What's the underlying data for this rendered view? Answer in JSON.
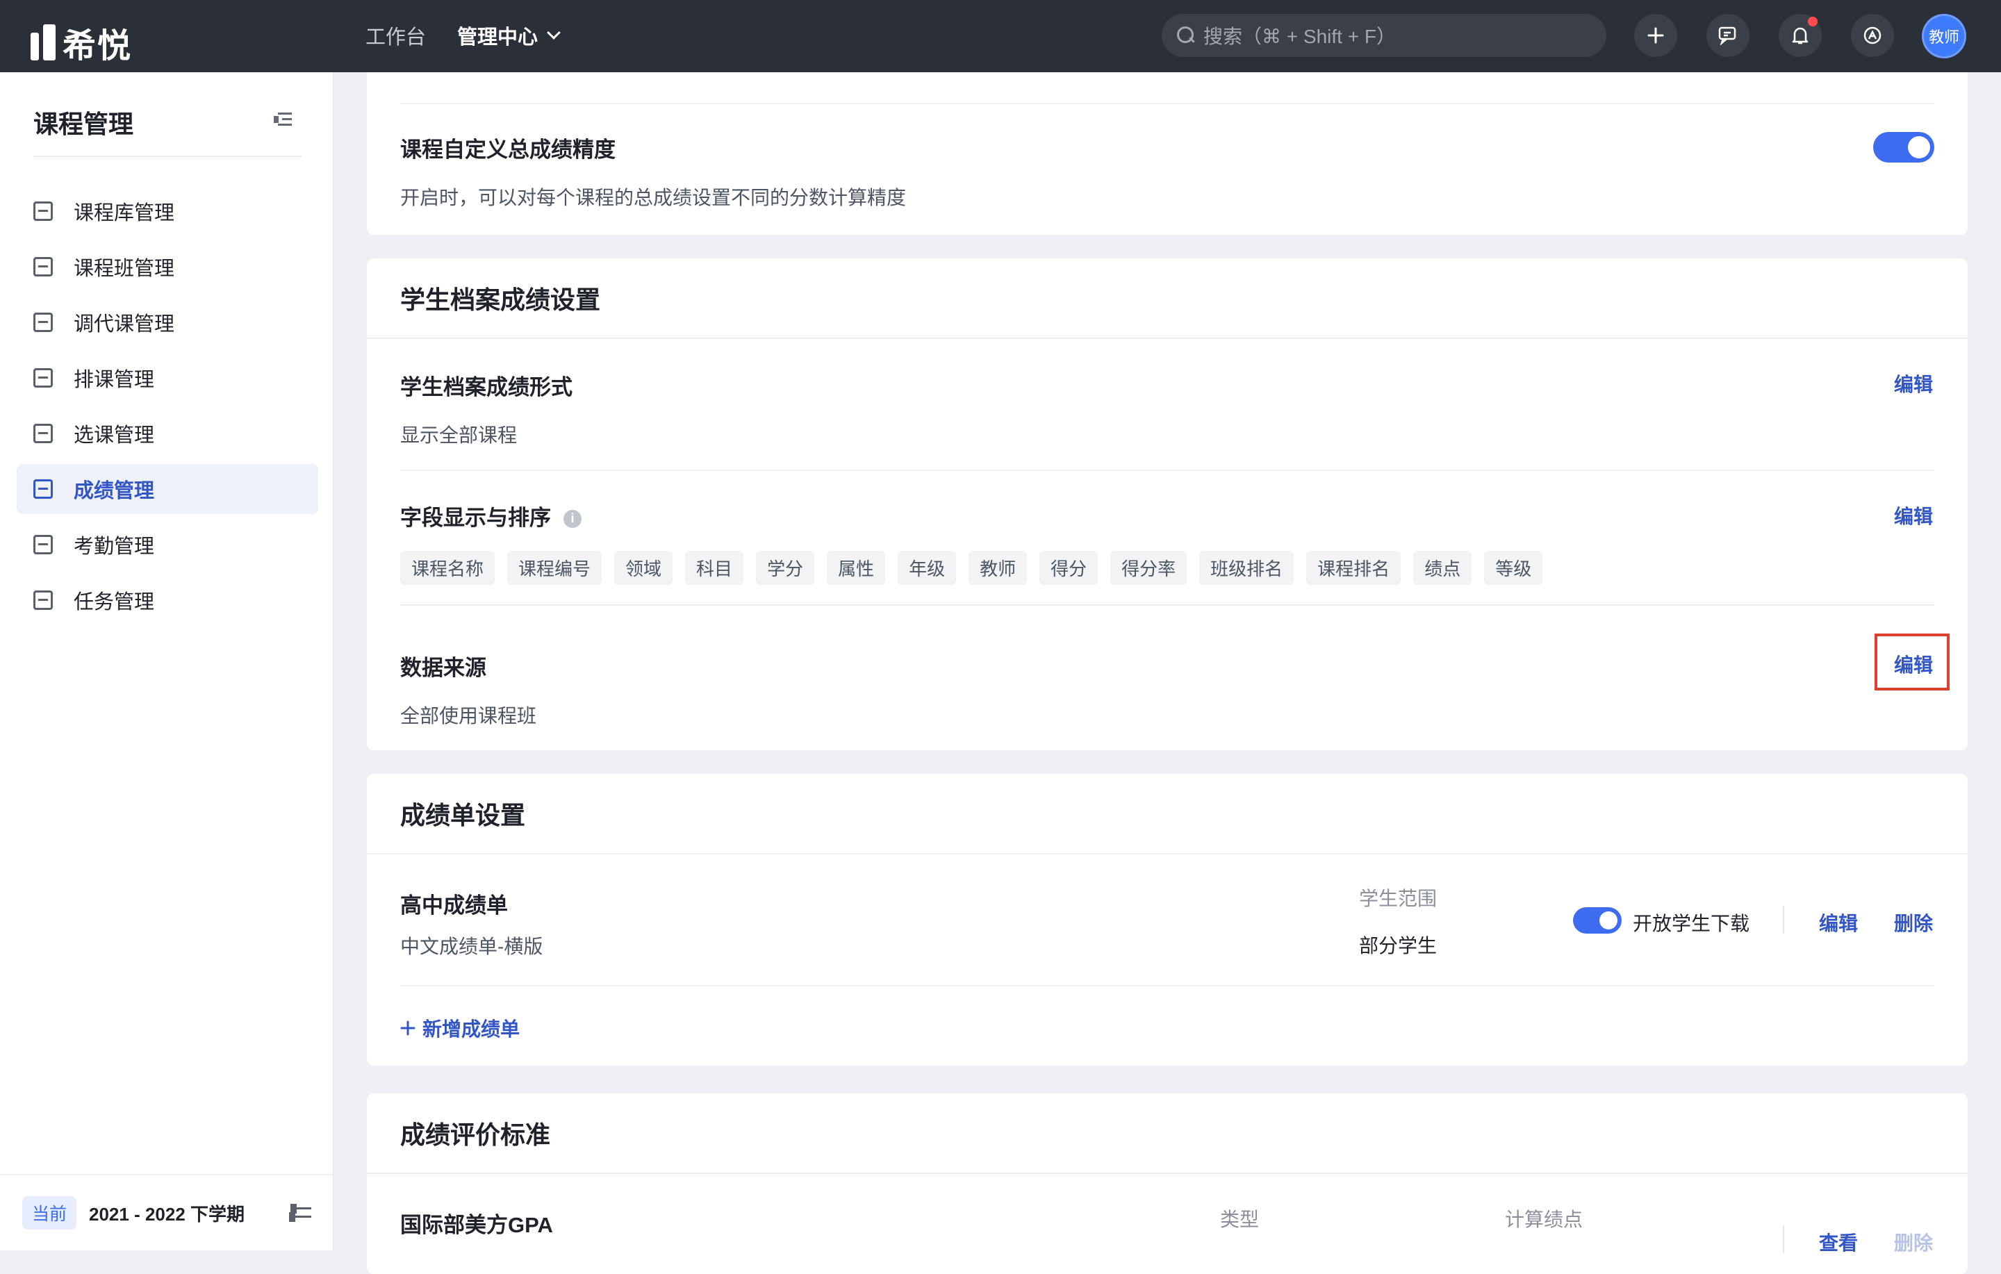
{
  "topbar": {
    "logo_text": "希悦",
    "nav": {
      "workbench": "工作台",
      "admin": "管理中心"
    },
    "search_placeholder": "搜索（⌘ + Shift + F）",
    "avatar_text": "教师"
  },
  "sidebar": {
    "title": "课程管理",
    "items": [
      {
        "label": "课程库管理",
        "icon": "course-library-icon"
      },
      {
        "label": "课程班管理",
        "icon": "course-class-icon"
      },
      {
        "label": "调代课管理",
        "icon": "substitute-icon"
      },
      {
        "label": "排课管理",
        "icon": "schedule-icon"
      },
      {
        "label": "选课管理",
        "icon": "course-selection-icon"
      },
      {
        "label": "成绩管理",
        "icon": "grades-icon",
        "active": true
      },
      {
        "label": "考勤管理",
        "icon": "attendance-icon"
      },
      {
        "label": "任务管理",
        "icon": "task-icon"
      }
    ],
    "term_badge": "当前",
    "term_text": "2021 - 2022 下学期"
  },
  "card_precision": {
    "title": "课程自定义总成绩精度",
    "desc": "开启时，可以对每个课程的总成绩设置不同的分数计算精度",
    "toggle_on": true
  },
  "card_archive": {
    "heading": "学生档案成绩设置",
    "form": {
      "title": "学生档案成绩形式",
      "desc": "显示全部课程",
      "edit": "编辑"
    },
    "fields": {
      "title": "字段显示与排序",
      "edit": "编辑",
      "tags": [
        "课程名称",
        "课程编号",
        "领域",
        "科目",
        "学分",
        "属性",
        "年级",
        "教师",
        "得分",
        "得分率",
        "班级排名",
        "课程排名",
        "绩点",
        "等级"
      ]
    },
    "source": {
      "title": "数据来源",
      "desc": "全部使用课程班",
      "edit": "编辑"
    }
  },
  "card_report": {
    "heading": "成绩单设置",
    "item": {
      "title": "高中成绩单",
      "desc": "中文成绩单-横版",
      "scope_label": "学生范围",
      "scope_value": "部分学生",
      "download_label": "开放学生下载",
      "download_on": true,
      "edit": "编辑",
      "delete": "删除"
    },
    "add_label": "新增成绩单"
  },
  "card_eval": {
    "heading": "成绩评价标准",
    "item": {
      "title": "国际部美方GPA",
      "type_label": "类型",
      "gpa_label": "计算绩点",
      "view": "查看",
      "delete": "删除"
    }
  },
  "colors": {
    "topbar": "#2b2f38",
    "accent": "#3256c8",
    "toggle": "#3e6cf0",
    "highlight": "#e0412f"
  }
}
